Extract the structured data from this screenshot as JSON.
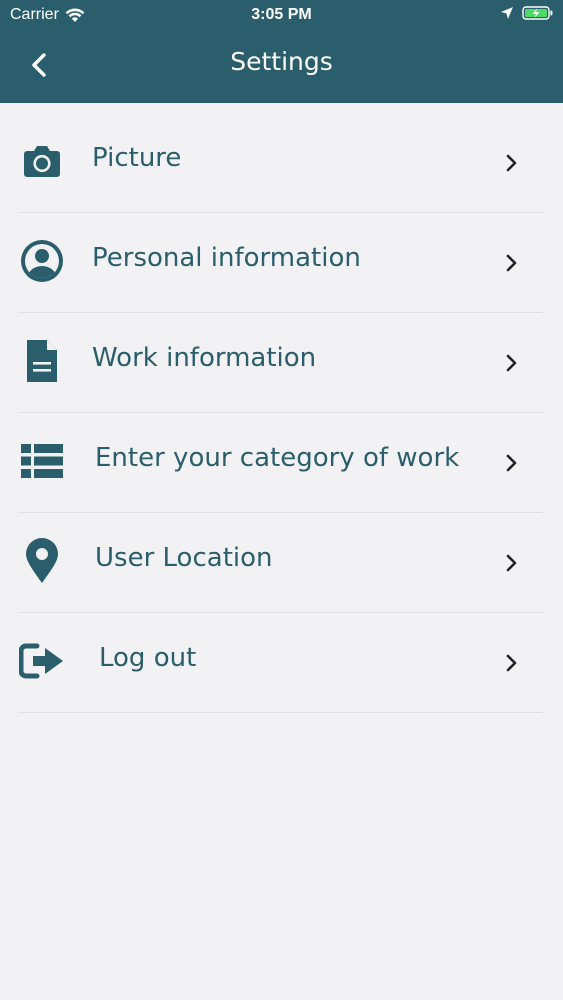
{
  "status_bar": {
    "carrier": "Carrier",
    "time": "3:05 PM"
  },
  "header": {
    "title": "Settings",
    "back_icon": "chevron-left-icon"
  },
  "colors": {
    "primary": "#2a5e6c",
    "background": "#f2f2f4",
    "battery_charge": "#4cd964"
  },
  "menu": {
    "items": [
      {
        "label": "Picture",
        "icon": "camera-icon"
      },
      {
        "label": "Personal information",
        "icon": "user-circle-icon"
      },
      {
        "label": "Work information",
        "icon": "document-icon"
      },
      {
        "label": "Enter your category of work",
        "icon": "list-icon"
      },
      {
        "label": "User Location",
        "icon": "location-pin-icon"
      },
      {
        "label": "Log out",
        "icon": "logout-icon"
      }
    ]
  }
}
